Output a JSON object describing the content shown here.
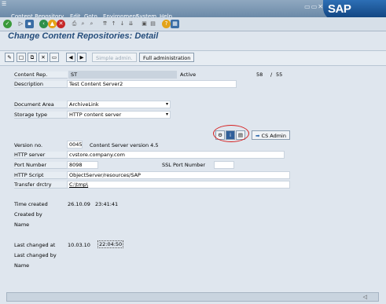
{
  "menu": [
    {
      "id": "content-repository",
      "label": "Content Repository",
      "u": "C"
    },
    {
      "id": "edit",
      "label": "Edit",
      "u": "E"
    },
    {
      "id": "goto",
      "label": "Goto",
      "u": "G"
    },
    {
      "id": "environment",
      "label": "Environment",
      "u": "v"
    },
    {
      "id": "system",
      "label": "System",
      "u": "S"
    },
    {
      "id": "help",
      "label": "Help",
      "u": "H"
    }
  ],
  "logo": "SAP",
  "title": "Change Content Repositories: Detail",
  "toolbar": {
    "simple_admin": "Simple admin.",
    "full_admin": "Full administration"
  },
  "form": {
    "content_rep_label": "Content Rep.",
    "content_rep_value": "ST",
    "status": "Active",
    "count_current": "58",
    "count_sep": "/",
    "count_total": "55",
    "description_label": "Description",
    "description_value": "Test Content Server2",
    "document_area_label": "Document Area",
    "document_area_value": "ArchiveLink",
    "storage_type_label": "Storage type",
    "storage_type_value": "HTTP content server",
    "cs_admin_label": "CS Admin",
    "version_label": "Version no.",
    "version_value": "0045",
    "version_text": "Content Server version 4.5",
    "http_server_label": "HTTP server",
    "http_server_value": "cvstore.company.com",
    "port_label": "Port Number",
    "port_value": "8098",
    "ssl_port_label": "SSL Port Number",
    "ssl_port_value": "",
    "http_script_label": "HTTP Script",
    "http_script_value": "ObjectServer/resources/SAP",
    "transfer_label": "Transfer drctry",
    "transfer_value": "C:\\tmp\\",
    "time_created_label": "Time created",
    "time_created_date": "26.10.09",
    "time_created_time": "23:41:41",
    "created_by_label": "Created by",
    "name1_label": "Name",
    "last_changed_label": "Last changed at",
    "last_changed_date": "10.03.10",
    "last_changed_time": "22:04:50",
    "last_changed_by_label": "Last changed by",
    "name2_label": "Name"
  }
}
